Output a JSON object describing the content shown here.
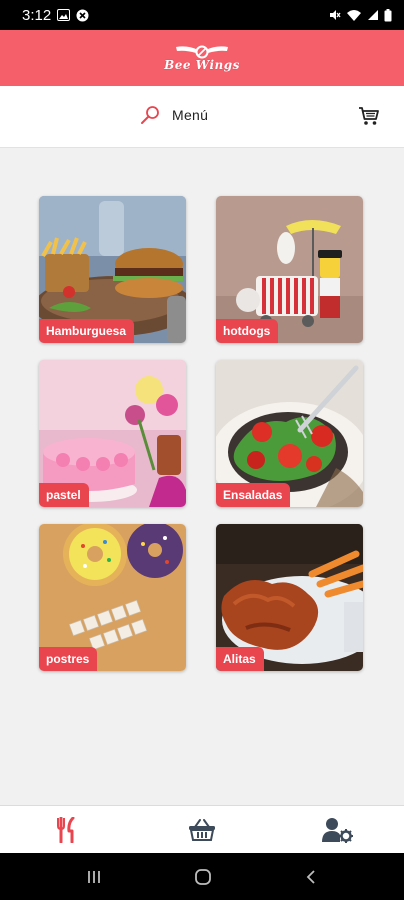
{
  "status_bar": {
    "time": "3:12",
    "icons": [
      "image-icon",
      "app-notification-icon",
      "mute-icon",
      "wifi-icon",
      "signal-icon",
      "battery-icon"
    ]
  },
  "header": {
    "logo_text": "Bee Wings",
    "accent_color": "#f55f6a"
  },
  "search": {
    "label": "Menú",
    "icon": "search-icon",
    "cart_icon": "cart-icon"
  },
  "categories": [
    {
      "label": "Hamburguesa"
    },
    {
      "label": "hotdogs"
    },
    {
      "label": "pastel"
    },
    {
      "label": "Ensaladas"
    },
    {
      "label": "postres"
    },
    {
      "label": "Alitas"
    }
  ],
  "label_color": "#e9454f",
  "bottom_nav": {
    "items": [
      {
        "icon": "fork-knife-icon",
        "active": true
      },
      {
        "icon": "basket-icon",
        "active": false
      },
      {
        "icon": "user-settings-icon",
        "active": false
      }
    ]
  }
}
